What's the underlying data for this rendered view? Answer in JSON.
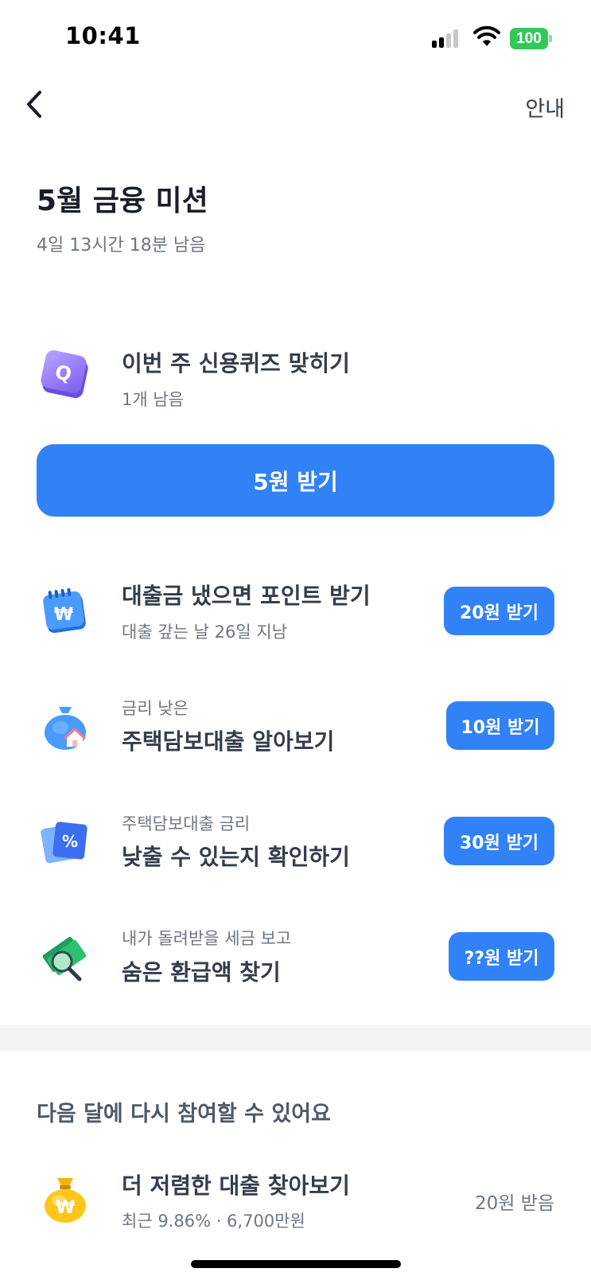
{
  "status_bar": {
    "time": "10:41",
    "battery": "100"
  },
  "nav": {
    "guide_label": "안내"
  },
  "header": {
    "title": "5월 금융 미션",
    "remaining": "4일 13시간 18분 남음"
  },
  "missions": [
    {
      "icon": "quiz-q-icon",
      "title": "이번 주 신용퀴즈 맞히기",
      "sub": "1개 남음",
      "button": "5원 받기"
    },
    {
      "icon": "calendar-won-icon",
      "title": "대출금 냈으면 포인트 받기",
      "sub": "대출 갚는 날 26일 지남",
      "button": "20원 받기"
    },
    {
      "icon": "money-bag-house-icon",
      "pre": "금리 낮은",
      "title": "주택담보대출 알아보기",
      "button": "10원 받기"
    },
    {
      "icon": "percent-card-icon",
      "pre": "주택담보대출 금리",
      "title": "낮출 수 있는지 확인하기",
      "button": "30원 받기"
    },
    {
      "icon": "money-magnifier-icon",
      "pre": "내가 돌려받을 세금 보고",
      "title": "숨은 환급액 찾기",
      "button": "??원 받기"
    }
  ],
  "next_month": {
    "heading": "다음 달에 다시 참여할 수 있어요",
    "items": [
      {
        "icon": "gold-money-bag-icon",
        "title": "더 저렴한 대출 찾아보기",
        "sub": "최근 9.86% · 6,700만원",
        "status": "20원 받음"
      }
    ]
  },
  "colors": {
    "accent": "#3182f6",
    "title": "#191f28",
    "sub": "#6b7684",
    "divider": "#f2f4f6"
  }
}
